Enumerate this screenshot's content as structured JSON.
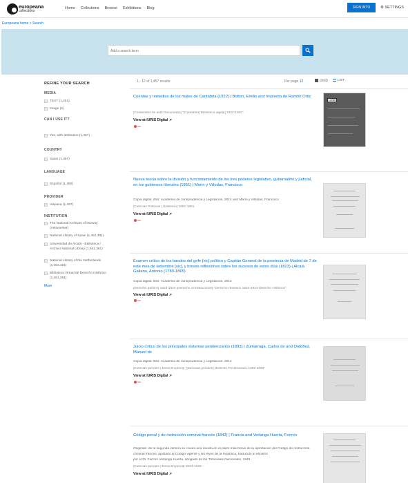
{
  "brand": {
    "name": "europeana",
    "sub": "collections"
  },
  "nav": [
    "Home",
    "Collections",
    "Browse",
    "Exhibitions",
    "Blog"
  ],
  "header": {
    "signin": "SIGN INTO",
    "settings": "SETTINGS"
  },
  "breadcrumb": "Europeana home > Search",
  "search": {
    "placeholder": "Add a search term"
  },
  "sidebar": {
    "title": "REFINE YOUR SEARCH",
    "facets": [
      {
        "head": "MEDIA",
        "items": [
          "TEXT (1,451)",
          "Image (6)"
        ]
      },
      {
        "head": "CAN I USE IT?",
        "items": [
          "Yes, with attribution (1,457)"
        ]
      },
      {
        "head": "COUNTRY",
        "items": [
          "Spain (1,457)"
        ]
      },
      {
        "head": "LANGUAGE",
        "items": [
          "Español (1,450)"
        ]
      },
      {
        "head": "PROVIDER",
        "items": [
          "Hispana (1,457)"
        ]
      },
      {
        "head": "INSTITUTION",
        "items": [
          "The National Archives of Norway (Arkivverket)",
          "National Library of Spain (1,451,361)",
          "Universidad de Alcalá - Biblioteca / Archivo National Library (1,451,361)",
          "National Library of the Netherlands (1,451,361)",
          "Biblioteca Virtual de Derecho Histórico (1,451,361)"
        ]
      }
    ],
    "more": "More"
  },
  "toolbar": {
    "count": "1 - 12 of 1,457 results",
    "perpage": "Per page",
    "perpage_value": "12",
    "grid": "GRID",
    "list": "LIST"
  },
  "results": [
    {
      "title": "Cuentas y remedios de los males de Cantabria (1922) | Botton, Emilio and Imprenta de Ramón Ortiz",
      "lines": [
        "[Contenidos de este Documento] \"[Cantabria] Biblioteca digital] 1922-1922\""
      ],
      "link": "View at IURIS Digital"
    },
    {
      "title": "Nueva teoría sobre la división y funcionamiento de los tres poderes legislativo, gubernativo y judicial, en los gobiernos liberales (1851) | Marín y Villodas, Francisco",
      "lines": [
        "Copia digital. Bsn: Academia de Jurisprudencia y Legislación, 2014 and Marín y Villodas, Francisco",
        "[Ciencias Políticas | Gobierno] 1851-1851"
      ],
      "link": "View at IURIS Digital"
    },
    {
      "title": "Examen crítico de los bandos del gefe [sic] político y Capitán General de la provincia de Madrid de 7 de este mes de setiembre [sic], y breves reflexiones sobre los sucesos de estos días (1823) | Alcalá Galiano, Antonio (1789-1865)",
      "lines": [
        "Copia digital. Bsn: Academia de Jurisprudencia y Legislación, 2014",
        "[Derecho público] 1823-1823 [Derecho Constitucional] \"Derecho Histórico 1823-1823 Derecho Histórico\""
      ],
      "link": "View at IURIS Digital"
    },
    {
      "title": "Juicio crítico de los principales sistemas penitenciarios (1893) | Zumárraga, Carlos de and Ordóñez, Manuel de",
      "lines": [
        "Copia digital. Bsn: Academia de Jurisprudencia y Legislación, 2014",
        "[Ciencias penales | Derecho penal] \"[Ciencias penales] Derecho Penitenciario 1893-1893\""
      ],
      "link": "View at IURIS Digital"
    },
    {
      "title": "Código penal y de instrucción criminal francés (1843) | Francia and Verlanga Huerta, Fermín",
      "lines": [
        "Originale: de la segunda versión se creará una revista en el plazo más breve de la aprobación del Código de Instrucción",
        "criminal francés: ajustado al Código vigente y las leyes de la república, traducido al español",
        "por el Dr. Fermín Verlanga Huerta, abogado de los Tribunales Nacionales, 1843",
        "[Ciencias penales | Derecho penal] 1843-1843"
      ],
      "link": "View at IURIS Digital"
    }
  ],
  "thumb_tag": "1.4069"
}
